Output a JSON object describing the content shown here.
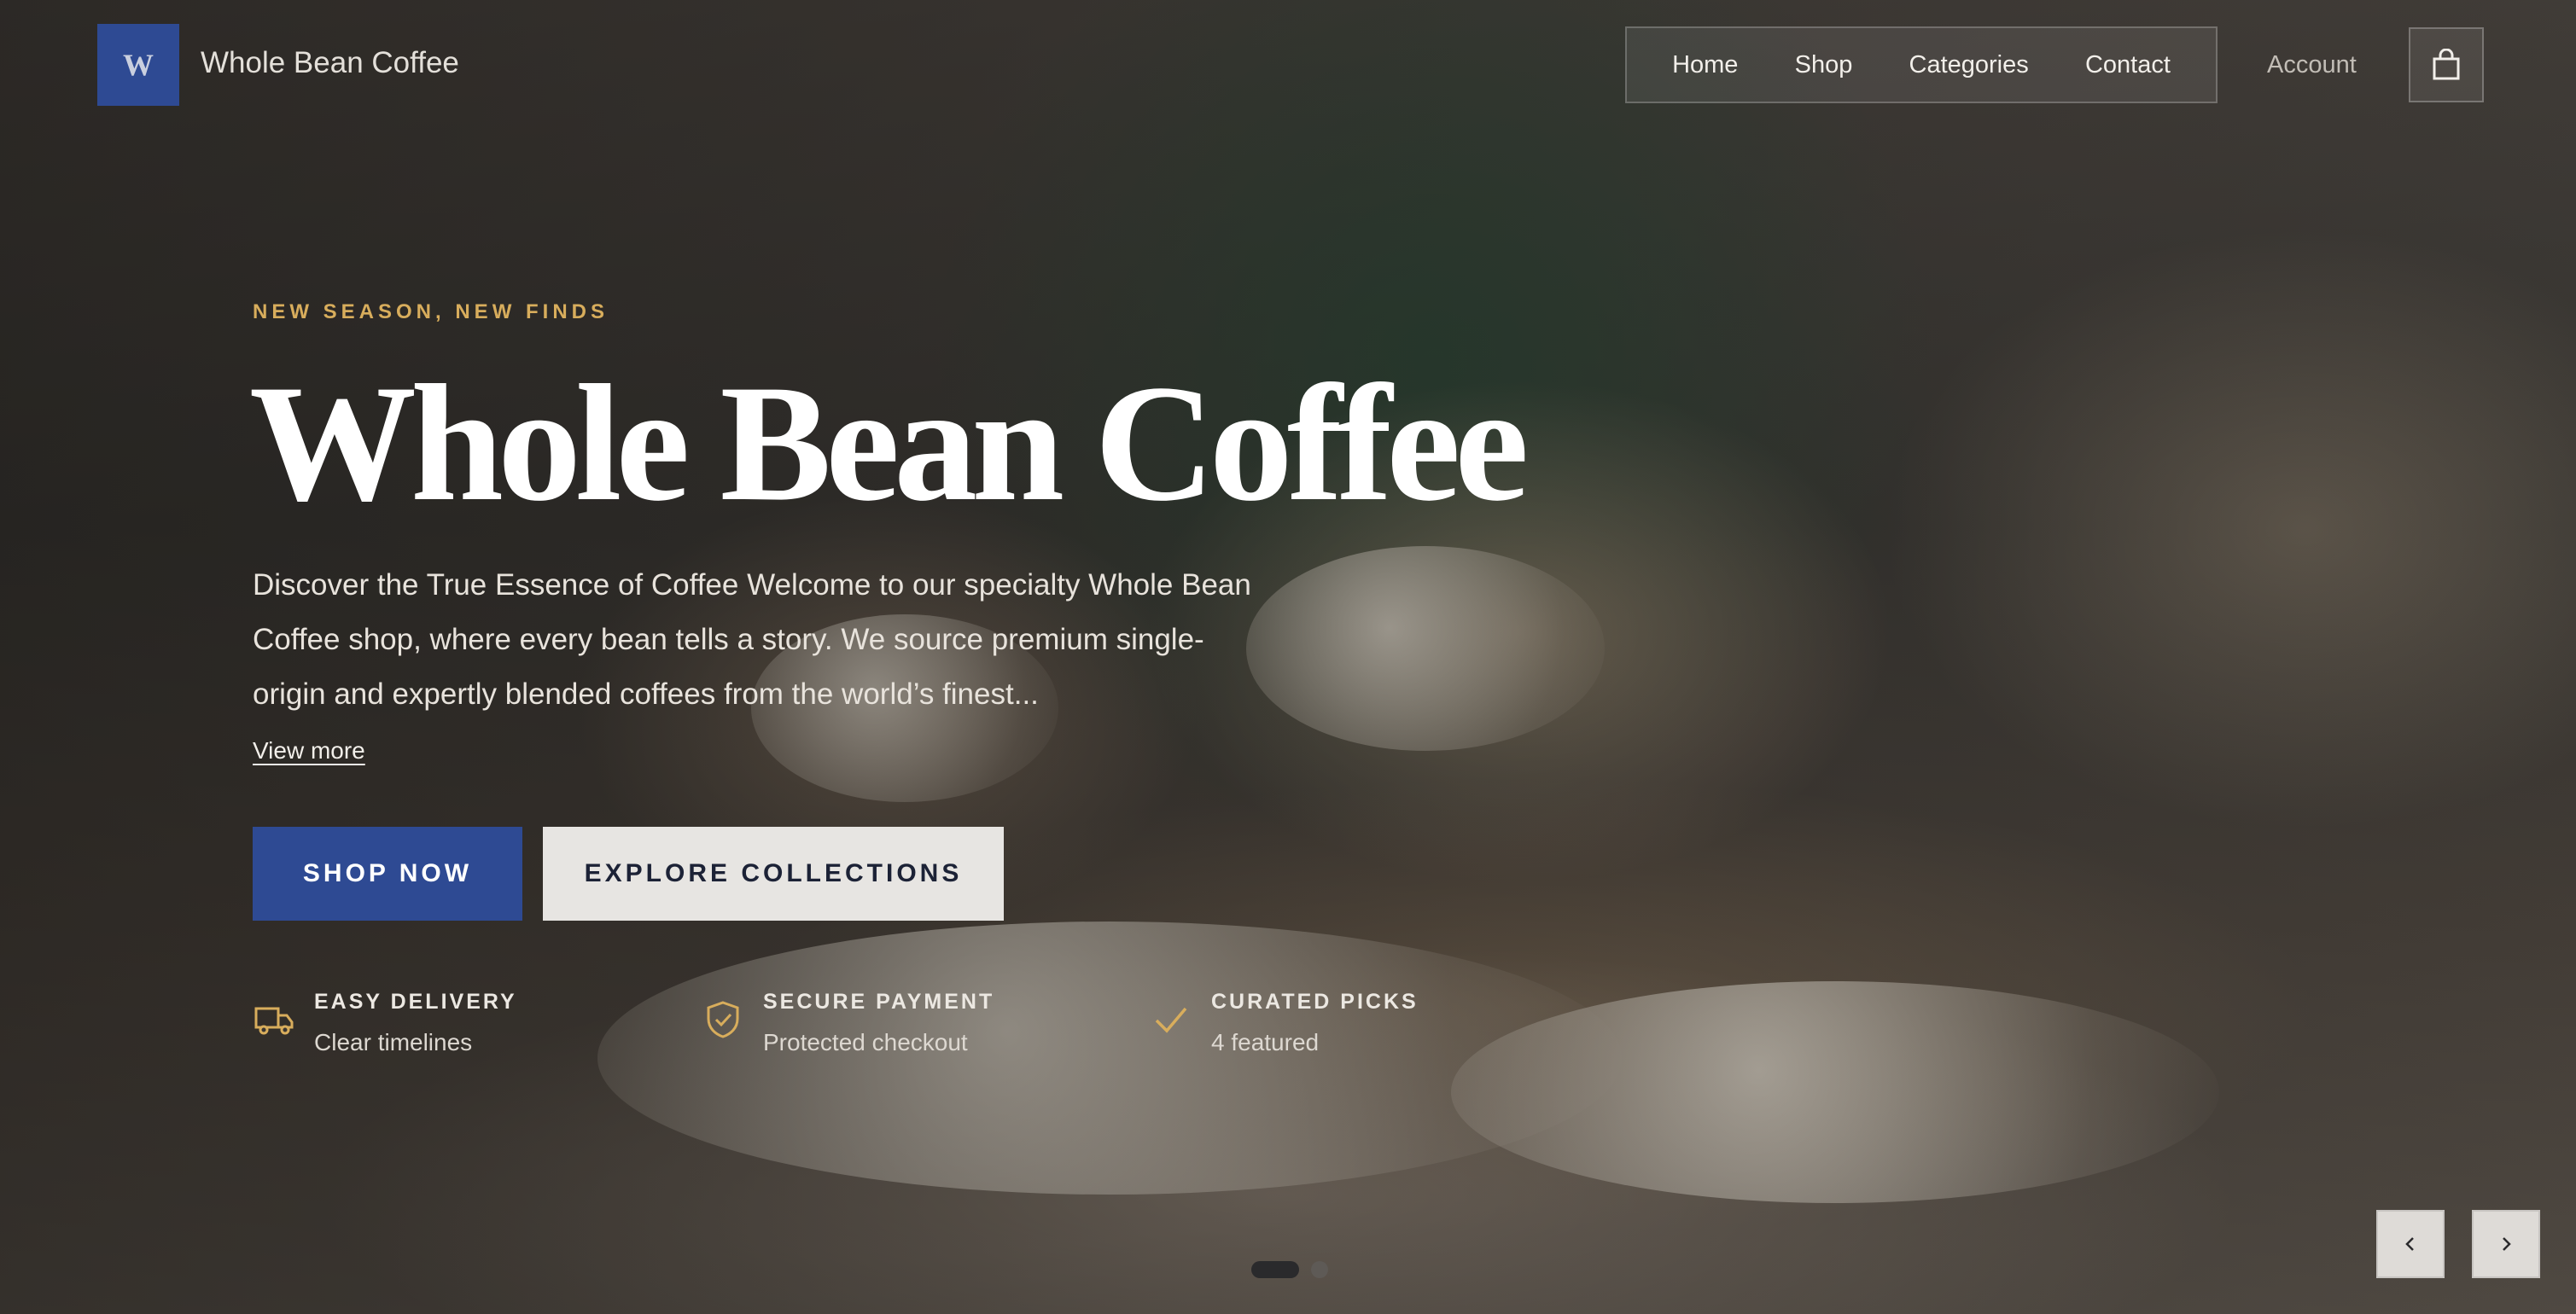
{
  "brand": {
    "logo_letter": "W",
    "name": "Whole Bean Coffee"
  },
  "nav": {
    "items": [
      {
        "label": "Home"
      },
      {
        "label": "Shop"
      },
      {
        "label": "Categories"
      },
      {
        "label": "Contact"
      }
    ],
    "account_label": "Account",
    "cart_icon": "shopping-bag-icon"
  },
  "hero": {
    "eyebrow": "NEW SEASON, NEW FINDS",
    "title": "Whole Bean Coffee",
    "description": "Discover the True Essence of Coffee Welcome to our specialty Whole Bean Coffee shop, where every bean tells a story. We source premium single-origin and expertly blended coffees from the world’s finest...",
    "view_more": "View more",
    "primary_cta": "SHOP NOW",
    "secondary_cta": "EXPLORE COLLECTIONS"
  },
  "features": [
    {
      "icon": "truck-icon",
      "title": "EASY DELIVERY",
      "subtitle": "Clear timelines"
    },
    {
      "icon": "shield-check-icon",
      "title": "SECURE PAYMENT",
      "subtitle": "Protected checkout"
    },
    {
      "icon": "check-icon",
      "title": "CURATED PICKS",
      "subtitle": "4 featured"
    }
  ],
  "carousel": {
    "slides": 2,
    "active_slide": 1,
    "prev_icon": "chevron-left-icon",
    "next_icon": "chevron-right-icon"
  },
  "colors": {
    "accent": "#2e4a93",
    "eyebrow": "#d8ad5c",
    "icon_gold": "#d8ad5c",
    "secondary_button": "#e7e5e2"
  }
}
